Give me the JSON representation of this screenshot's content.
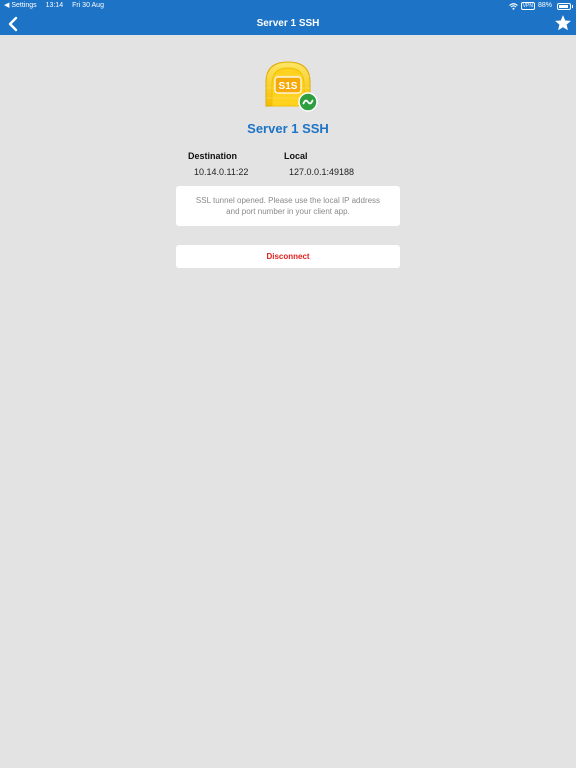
{
  "status_bar": {
    "back_app": "◀ Settings",
    "time": "13:14",
    "date": "Fri 30 Aug",
    "vpn_label": "VPN",
    "battery_percent": "88%",
    "battery_level": 0.88
  },
  "nav": {
    "title": "Server 1 SSH"
  },
  "app_icon": {
    "label": "S1S"
  },
  "main": {
    "server_name": "Server 1 SSH",
    "destination_label": "Destination",
    "destination_value": "10.14.0.11:22",
    "local_label": "Local",
    "local_value": "127.0.0.1:49188",
    "message": "SSL tunnel opened. Please use the local IP address and port number in your client app.",
    "disconnect_label": "Disconnect"
  },
  "colors": {
    "accent": "#1d74c6",
    "background": "#e3e3e3",
    "danger": "#e41f1f",
    "status_ok": "#2e9e3e",
    "icon_yellow": "#f2c80f"
  }
}
